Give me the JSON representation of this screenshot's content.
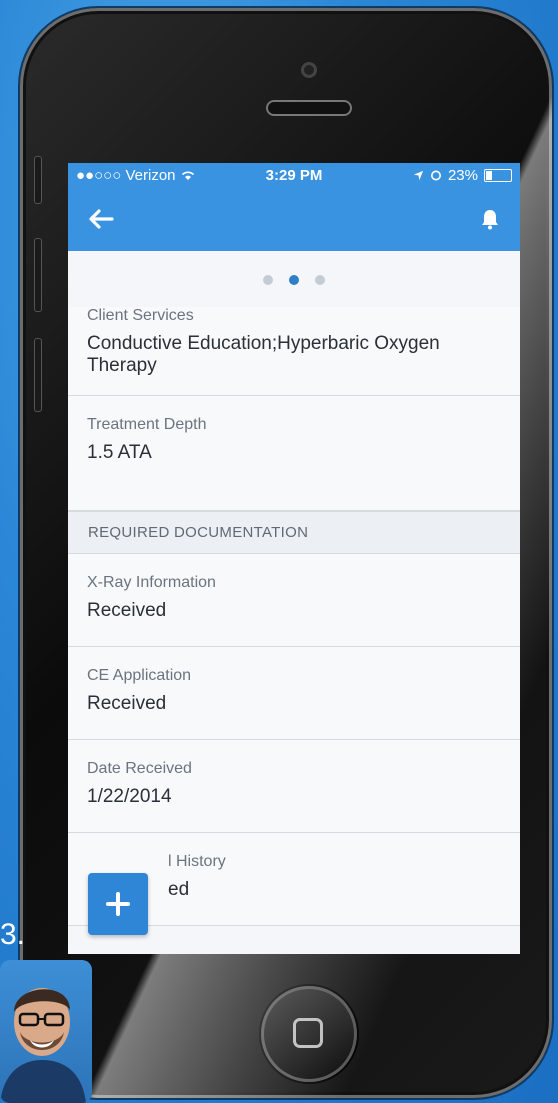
{
  "status_bar": {
    "carrier": "●●○○○ Verizon",
    "time": "3:29 PM",
    "battery": "23%"
  },
  "nav": {
    "back_icon": "back-arrow-icon",
    "notification_icon": "bell-icon"
  },
  "pager": {
    "count": 3,
    "active": 2
  },
  "fields_top": [
    {
      "label": "Client Services",
      "value": "Conductive Education;Hyperbaric Oxygen Therapy"
    },
    {
      "label": "Treatment Depth",
      "value": "1.5 ATA"
    }
  ],
  "section_header": "REQUIRED DOCUMENTATION",
  "fields_docs": [
    {
      "label": "X-Ray Information",
      "value": "Received"
    },
    {
      "label": "CE Application",
      "value": "Received"
    },
    {
      "label": "Date Received",
      "value": "1/22/2014"
    },
    {
      "label": "l History",
      "value": "ed"
    }
  ],
  "fab_icon": "plus-icon",
  "slide_fragment": "3.",
  "colors": {
    "accent": "#3a93e0",
    "fab": "#2f86d6",
    "background": "#2a86d6"
  }
}
